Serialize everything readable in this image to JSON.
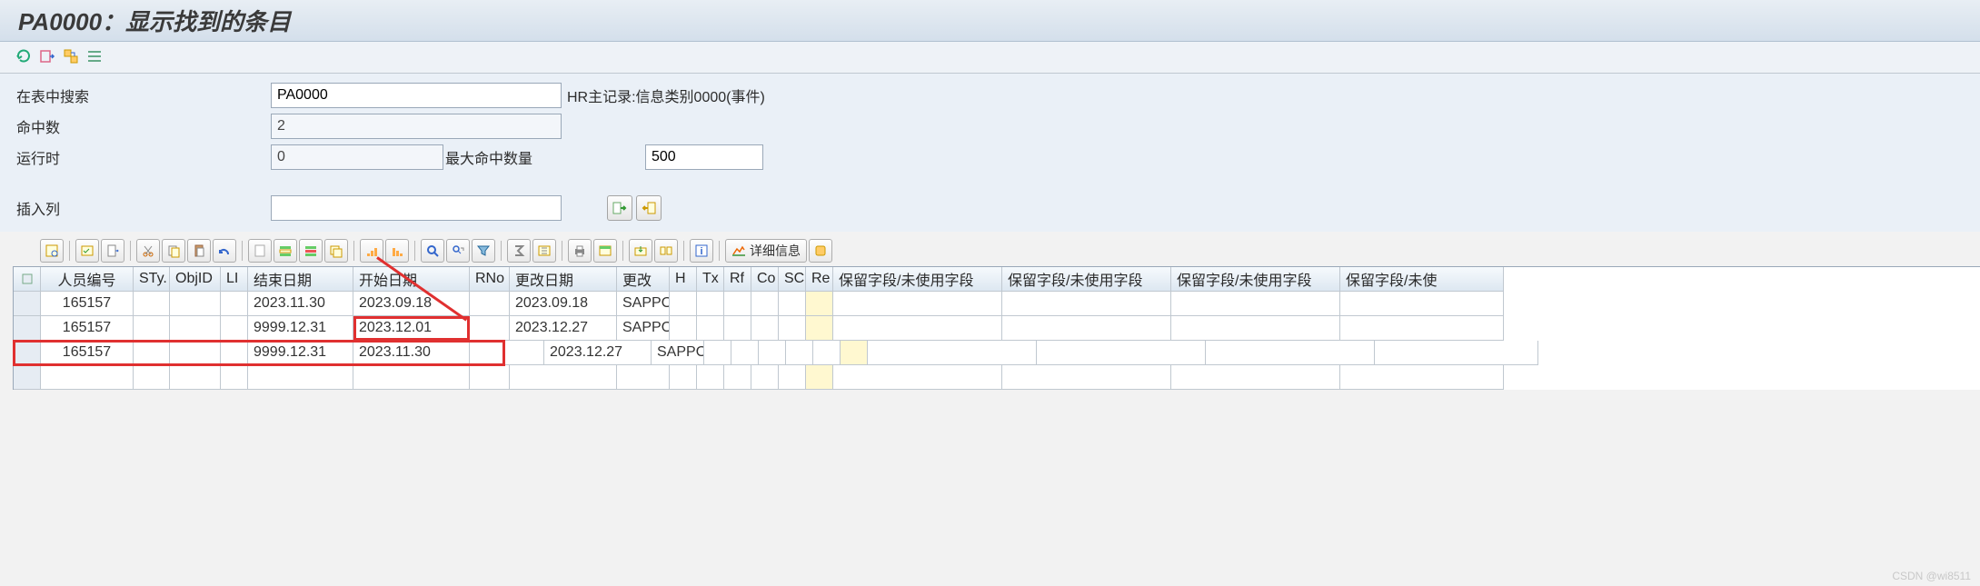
{
  "title": "PA0000：显示找到的条目",
  "search": {
    "label": "在表中搜索",
    "value": "PA0000",
    "description": "HR主记录:信息类别0000(事件)"
  },
  "hits": {
    "label": "命中数",
    "value": "2"
  },
  "runtime": {
    "label": "运行时",
    "value": "0",
    "max_label": "最大命中数量",
    "max_value": "500"
  },
  "insert_col": {
    "label": "插入列",
    "value": ""
  },
  "detail_button": "详细信息",
  "columns": [
    "",
    "人员编号",
    "STy.",
    "ObjID",
    "LI",
    "结束日期",
    "开始日期",
    "RNo",
    "更改日期",
    "更改",
    "H",
    "Tx",
    "Rf",
    "Co",
    "SC",
    "Re",
    "保留字段/未使用字段",
    "保留字段/未使用字段",
    "保留字段/未使用字段",
    "保留字段/未使"
  ],
  "rows": [
    {
      "pernr": "165157",
      "sty": "",
      "obj": "",
      "li": "",
      "end": "2023.11.30",
      "beg": "2023.09.18",
      "rno": "",
      "cdat": "2023.09.18",
      "cusr": "SAPPO"
    },
    {
      "pernr": "165157",
      "sty": "",
      "obj": "",
      "li": "",
      "end": "9999.12.31",
      "beg": "2023.12.01",
      "rno": "",
      "cdat": "2023.12.27",
      "cusr": "SAPPO"
    },
    {
      "pernr": "165157",
      "sty": "",
      "obj": "",
      "li": "",
      "end": "9999.12.31",
      "beg": "2023.11.30",
      "rno": "",
      "cdat": "2023.12.27",
      "cusr": "SAPPO"
    }
  ],
  "watermark": "CSDN @wi8511"
}
